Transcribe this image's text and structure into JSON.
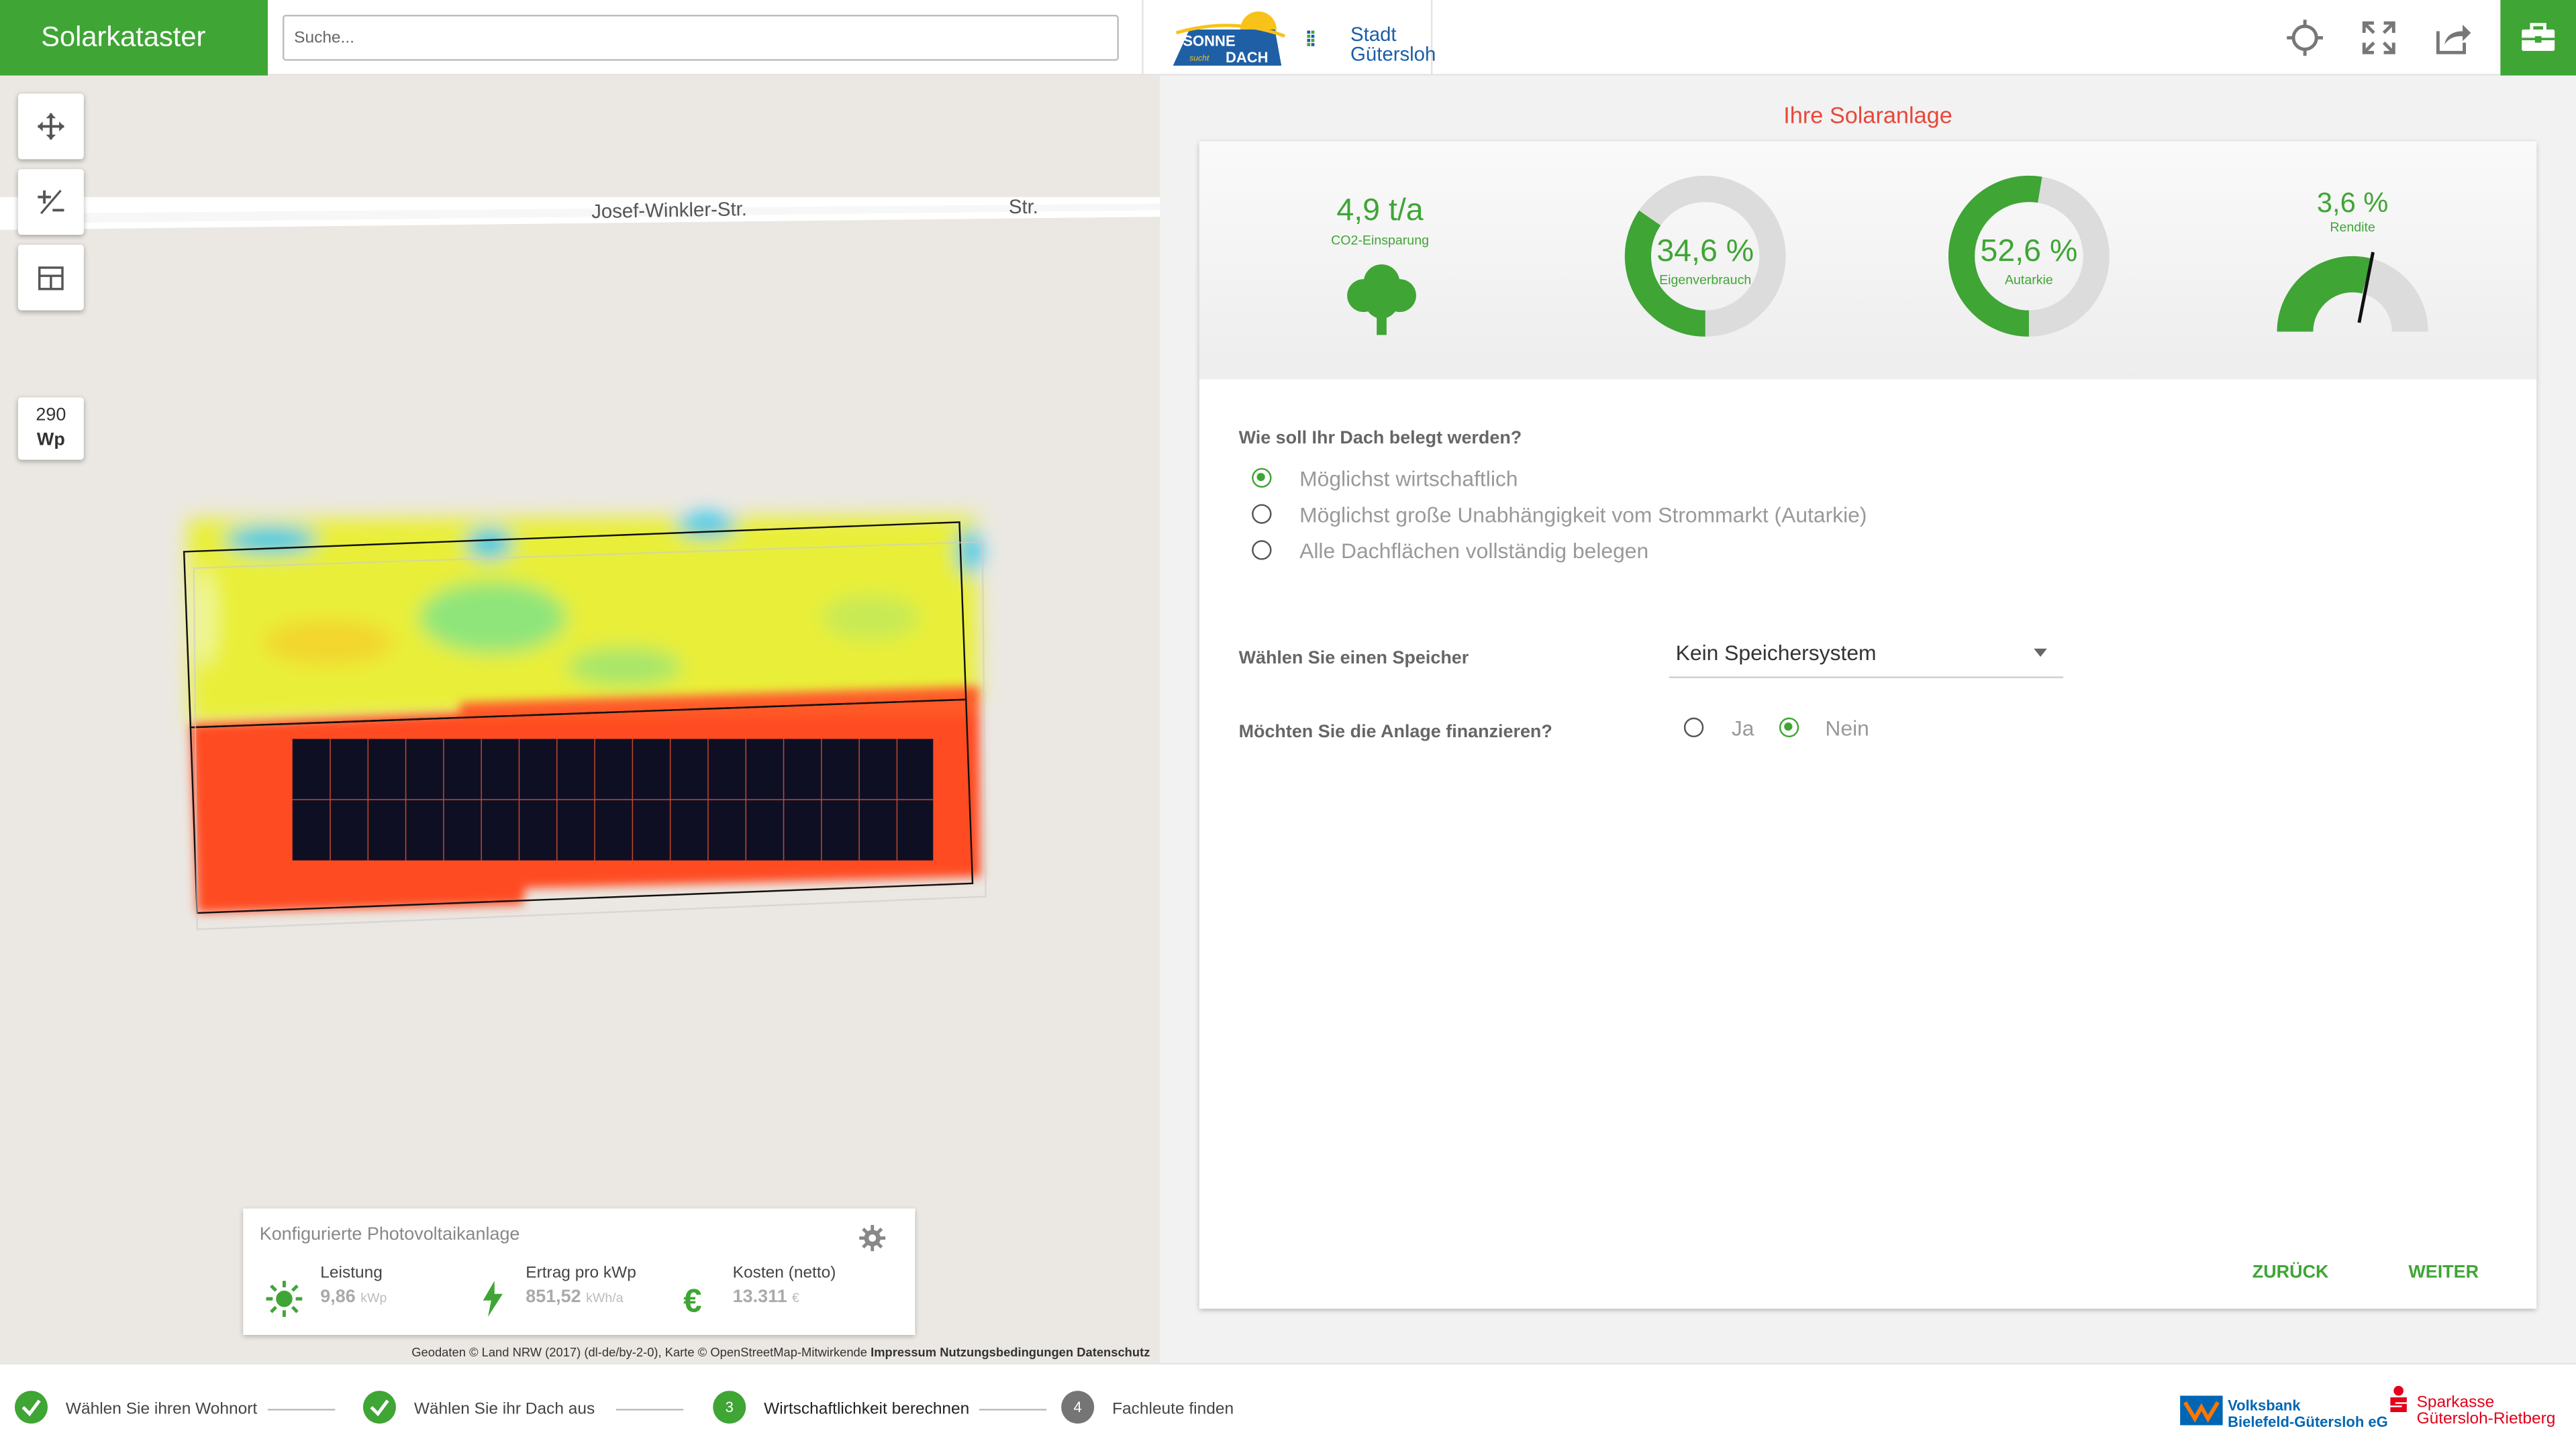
{
  "header": {
    "brand": "Solarkataster",
    "search_placeholder": "Suche...",
    "logo_sonne": "SONNE sucht DACH",
    "logo_stadt_line1": "Stadt",
    "logo_stadt_line2": "Gütersloh",
    "icons": [
      "crosshair-icon",
      "fullscreen-icon",
      "share-icon",
      "toolbox-icon"
    ],
    "accent": "#3fa535"
  },
  "map": {
    "street_main": "Josef-Winkler-Str.",
    "street_secondary": "Str.",
    "controls": [
      "move-icon",
      "plus-minus-icon",
      "panel-layout-icon"
    ],
    "module_power": "290",
    "module_unit": "Wp",
    "attribution": "Geodaten © Land NRW (2017) (dl-de/by-2-0), Karte © OpenStreetMap-Mitwirkende",
    "link_impressum": "Impressum",
    "link_terms": "Nutzungsbedingungen",
    "link_privacy": "Datenschutz"
  },
  "pv_card": {
    "title": "Konfigurierte Photovoltaikanlage",
    "items": [
      {
        "label": "Leistung",
        "value": "9,86",
        "unit": "kWp",
        "icon": "sun-icon"
      },
      {
        "label": "Ertrag pro kWp",
        "value": "851,52",
        "unit": "kWh/a",
        "icon": "lightning-icon"
      },
      {
        "label": "Kosten (netto)",
        "value": "13.311",
        "unit": "€",
        "icon": "euro-icon"
      }
    ]
  },
  "panel": {
    "title": "Ihre Solaranlage",
    "title_color": "#e8473a",
    "stats": {
      "co2": {
        "value": "4,9 t/a",
        "label": "CO2-Einsparung",
        "icon": "tree-icon"
      },
      "eigenverbrauch": {
        "value": "34,6 %",
        "label": "Eigenverbrauch",
        "fraction": 0.346
      },
      "autarkie": {
        "value": "52,6 %",
        "label": "Autarkie",
        "fraction": 0.526
      },
      "rendite": {
        "value": "3,6 %",
        "label": "Rendite",
        "gauge_fraction": 0.58
      }
    },
    "q_belegung": "Wie soll Ihr Dach belegt werden?",
    "options": [
      {
        "label": "Möglichst wirtschaftlich",
        "checked": true
      },
      {
        "label": "Möglichst große Unabhängigkeit vom Strommarkt (Autarkie)",
        "checked": false
      },
      {
        "label": "Alle Dachflächen vollständig belegen",
        "checked": false
      }
    ],
    "q_speicher": "Wählen Sie einen Speicher",
    "speicher_value": "Kein Speichersystem",
    "q_finanzierung": "Möchten Sie die Anlage finanzieren?",
    "fin_ja": "Ja",
    "fin_nein": "Nein",
    "btn_back": "ZURÜCK",
    "btn_next": "WEITER"
  },
  "steps": [
    {
      "label": "Wählen Sie ihren Wohnort",
      "state": "done"
    },
    {
      "label": "Wählen Sie ihr Dach aus",
      "state": "done"
    },
    {
      "number": "3",
      "label": "Wirtschaftlichkeit berechnen",
      "state": "active"
    },
    {
      "number": "4",
      "label": "Fachleute finden",
      "state": "todo"
    }
  ],
  "sponsors": {
    "volksbank_1": "Volksbank",
    "volksbank_2": "Bielefeld-Gütersloh eG",
    "sparkasse_1": "Sparkasse",
    "sparkasse_2": "Gütersloh-Rietberg",
    "volksbank_color": "#0066b3",
    "sparkasse_color": "#e2001a"
  }
}
